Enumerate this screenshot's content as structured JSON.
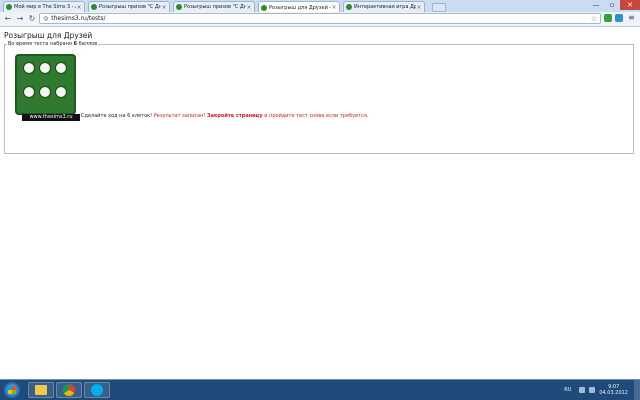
{
  "browser": {
    "tabs": [
      {
        "label": "Мой мир в The Sims 3 - Al",
        "active": false
      },
      {
        "label": "Розыгрыш призов \"С Дню",
        "active": false
      },
      {
        "label": "Розыгрыш призов \"С Дню",
        "active": false
      },
      {
        "label": "Розыгрыш для Друзей - Е",
        "active": true
      },
      {
        "label": "Интерактивная игра Друз",
        "active": false
      }
    ],
    "address": "thesims3.ru/tests/",
    "window_controls": {
      "minimize": "—",
      "maximize": "▫",
      "close": "✕"
    }
  },
  "page": {
    "title": "Розыгрыш для Друзей",
    "legend_prefix": "Во время теста набрано",
    "legend_score": "6",
    "legend_suffix": "баллов",
    "dice_value": 6,
    "brand": "www.thesims3.ru",
    "result_text_1": "Сделайте ход на 6 клеток!",
    "result_text_2": "Результат записан!",
    "result_text_3": "Закройте страницу",
    "result_text_4": "и пройдите тест снова если требуется."
  },
  "taskbar": {
    "language": "RU",
    "time": "9:07",
    "date": "04.03.2012"
  },
  "colors": {
    "dice_green": "#2f7a2f",
    "red_text": "#d42020",
    "taskbar": "#1f4b7a"
  }
}
